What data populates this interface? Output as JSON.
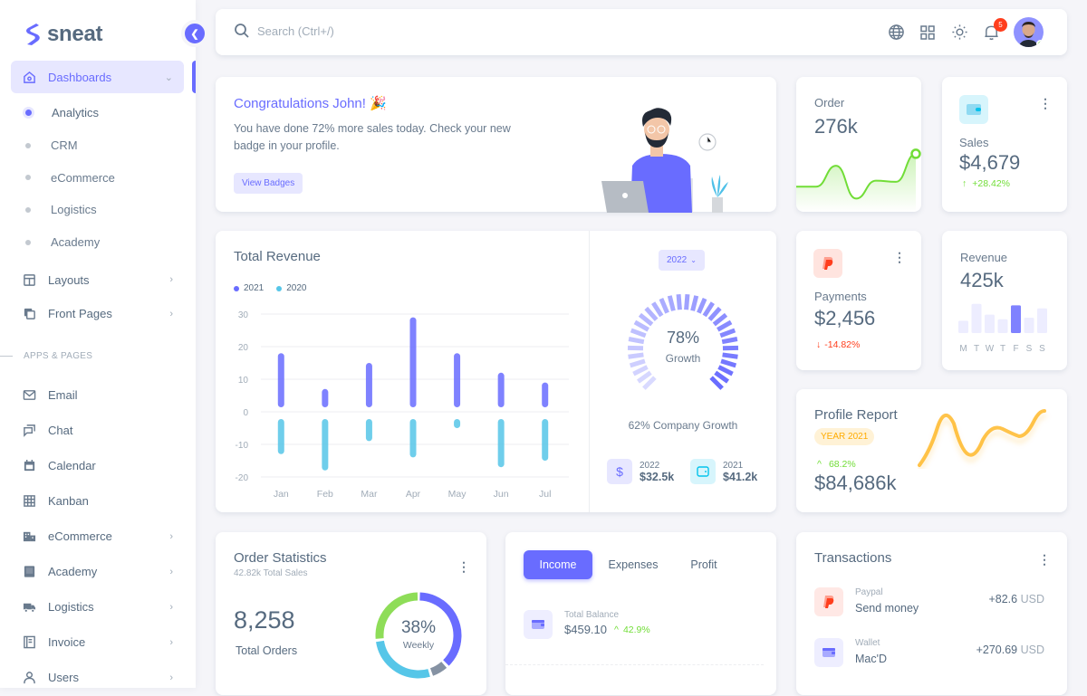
{
  "brand": {
    "name": "sneat"
  },
  "sidebar": {
    "dashboards": {
      "label": "Dashboards",
      "icon": "home-icon"
    },
    "dashboard_items": [
      {
        "label": "Analytics",
        "active": true
      },
      {
        "label": "CRM"
      },
      {
        "label": "eCommerce"
      },
      {
        "label": "Logistics"
      },
      {
        "label": "Academy"
      }
    ],
    "top_items": [
      {
        "label": "Layouts",
        "icon": "layout-icon",
        "has_children": true
      },
      {
        "label": "Front Pages",
        "icon": "pages-icon",
        "has_children": true
      }
    ],
    "section_header": "APPS & PAGES",
    "app_items": [
      {
        "label": "Email",
        "icon": "mail-icon",
        "has_children": false
      },
      {
        "label": "Chat",
        "icon": "chat-icon",
        "has_children": false
      },
      {
        "label": "Calendar",
        "icon": "calendar-icon",
        "has_children": false
      },
      {
        "label": "Kanban",
        "icon": "grid-icon",
        "has_children": false
      },
      {
        "label": "eCommerce",
        "icon": "store-icon",
        "has_children": true
      },
      {
        "label": "Academy",
        "icon": "book-icon",
        "has_children": true
      },
      {
        "label": "Logistics",
        "icon": "truck-icon",
        "has_children": true
      },
      {
        "label": "Invoice",
        "icon": "invoice-icon",
        "has_children": true
      },
      {
        "label": "Users",
        "icon": "user-icon",
        "has_children": true
      }
    ]
  },
  "navbar": {
    "search_placeholder": "Search (Ctrl+/)",
    "notification_count": "5"
  },
  "congrats": {
    "title": "Congratulations John! 🎉",
    "text": "You have done 72% more sales today. Check your new badge in your profile.",
    "button": "View Badges"
  },
  "order": {
    "label": "Order",
    "value": "276k",
    "sparkline": [
      30,
      30,
      65,
      10,
      40,
      38,
      85
    ]
  },
  "sales": {
    "label": "Sales",
    "value": "$4,679",
    "change": "+28.42%"
  },
  "payments": {
    "label": "Payments",
    "value": "$2,456",
    "change": "-14.82%"
  },
  "revenue_small": {
    "label": "Revenue",
    "value": "425k",
    "days": [
      "M",
      "T",
      "W",
      "T",
      "F",
      "S",
      "S"
    ],
    "values": [
      40,
      95,
      60,
      45,
      90,
      50,
      80
    ],
    "highlight_index": 4
  },
  "growth": {
    "year_select": "2022",
    "percent": "78%",
    "label": "Growth",
    "value": 78,
    "company_growth": "62% Company Growth",
    "stats": [
      {
        "year": "2022",
        "value": "$32.5k",
        "icon": "dollar-icon"
      },
      {
        "year": "2021",
        "value": "$41.2k",
        "icon": "wallet-icon"
      }
    ]
  },
  "profile_report": {
    "title": "Profile Report",
    "badge": "YEAR 2021",
    "change": "68.2%",
    "value": "$84,686k"
  },
  "order_stats": {
    "title": "Order Statistics",
    "subtitle": "42.82k Total Sales",
    "value": "8,258",
    "value_label": "Total Orders",
    "donut_percent": "38%",
    "donut_label": "Weekly",
    "donut_segments": [
      {
        "value": 38,
        "color": "#696cff"
      },
      {
        "value": 7,
        "color": "#8592a3"
      },
      {
        "value": 28,
        "color": "#56c6e8"
      },
      {
        "value": 27,
        "color": "#8edd58"
      }
    ]
  },
  "income": {
    "tabs": [
      "Income",
      "Expenses",
      "Profit"
    ],
    "active_tab": 0,
    "balance_label": "Total Balance",
    "balance_value": "$459.10",
    "balance_change": "42.9%"
  },
  "transactions": {
    "title": "Transactions",
    "items": [
      {
        "source": "Paypal",
        "desc": "Send money",
        "amount": "+82.6",
        "currency": "USD",
        "icon": "paypal-icon"
      },
      {
        "source": "Wallet",
        "desc": "Mac'D",
        "amount": "+270.69",
        "currency": "USD",
        "icon": "wallet-icon"
      }
    ]
  },
  "chart_data": {
    "type": "bar",
    "title": "Total Revenue",
    "categories": [
      "Jan",
      "Feb",
      "Mar",
      "Apr",
      "May",
      "Jun",
      "Jul"
    ],
    "series": [
      {
        "name": "2021",
        "color": "#696cff",
        "values": [
          18,
          7,
          15,
          29,
          18,
          12,
          9
        ]
      },
      {
        "name": "2020",
        "color": "#56c6e8",
        "values": [
          -13,
          -18,
          -9,
          -14,
          -5,
          -17,
          -15
        ]
      }
    ],
    "yticks": [
      30,
      20,
      10,
      0,
      -10,
      -20
    ],
    "ylim": [
      -20,
      30
    ],
    "grid": true,
    "legend": "top-left",
    "xlabel": "",
    "ylabel": ""
  }
}
